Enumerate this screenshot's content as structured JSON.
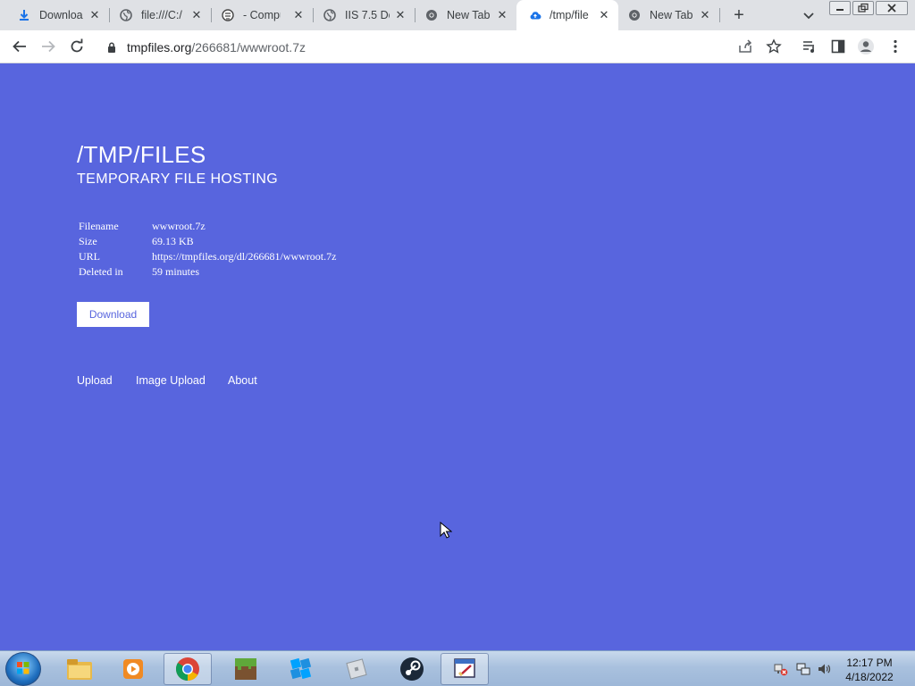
{
  "browser": {
    "tabs": [
      {
        "title": "Downloa",
        "icon": "download-icon"
      },
      {
        "title": "file:///C:/",
        "icon": "globe-icon"
      },
      {
        "title": "- Compu",
        "icon": "app-icon"
      },
      {
        "title": "IIS 7.5 De",
        "icon": "globe-icon"
      },
      {
        "title": "New Tab",
        "icon": "chrome-icon"
      },
      {
        "title": "/tmp/file",
        "icon": "cloud-upload-icon"
      },
      {
        "title": "New Tab",
        "icon": "chrome-icon"
      }
    ],
    "address": {
      "host": "tmpfiles.org",
      "path": "/266681/wwwroot.7z"
    }
  },
  "page": {
    "title": "/TMP/FILES",
    "subtitle": "TEMPORARY FILE HOSTING",
    "info": [
      {
        "key": "Filename",
        "value": "wwwroot.7z"
      },
      {
        "key": "Size",
        "value": "69.13 KB"
      },
      {
        "key": "URL",
        "value": "https://tmpfiles.org/dl/266681/wwwroot.7z"
      },
      {
        "key": "Deleted in",
        "value": "59 minutes"
      }
    ],
    "download_label": "Download",
    "nav": [
      "Upload",
      "Image Upload",
      "About"
    ]
  },
  "taskbar": {
    "time": "12:17 PM",
    "date": "4/18/2022"
  },
  "colors": {
    "page_background": "#5865de",
    "button_text": "#5865de"
  }
}
